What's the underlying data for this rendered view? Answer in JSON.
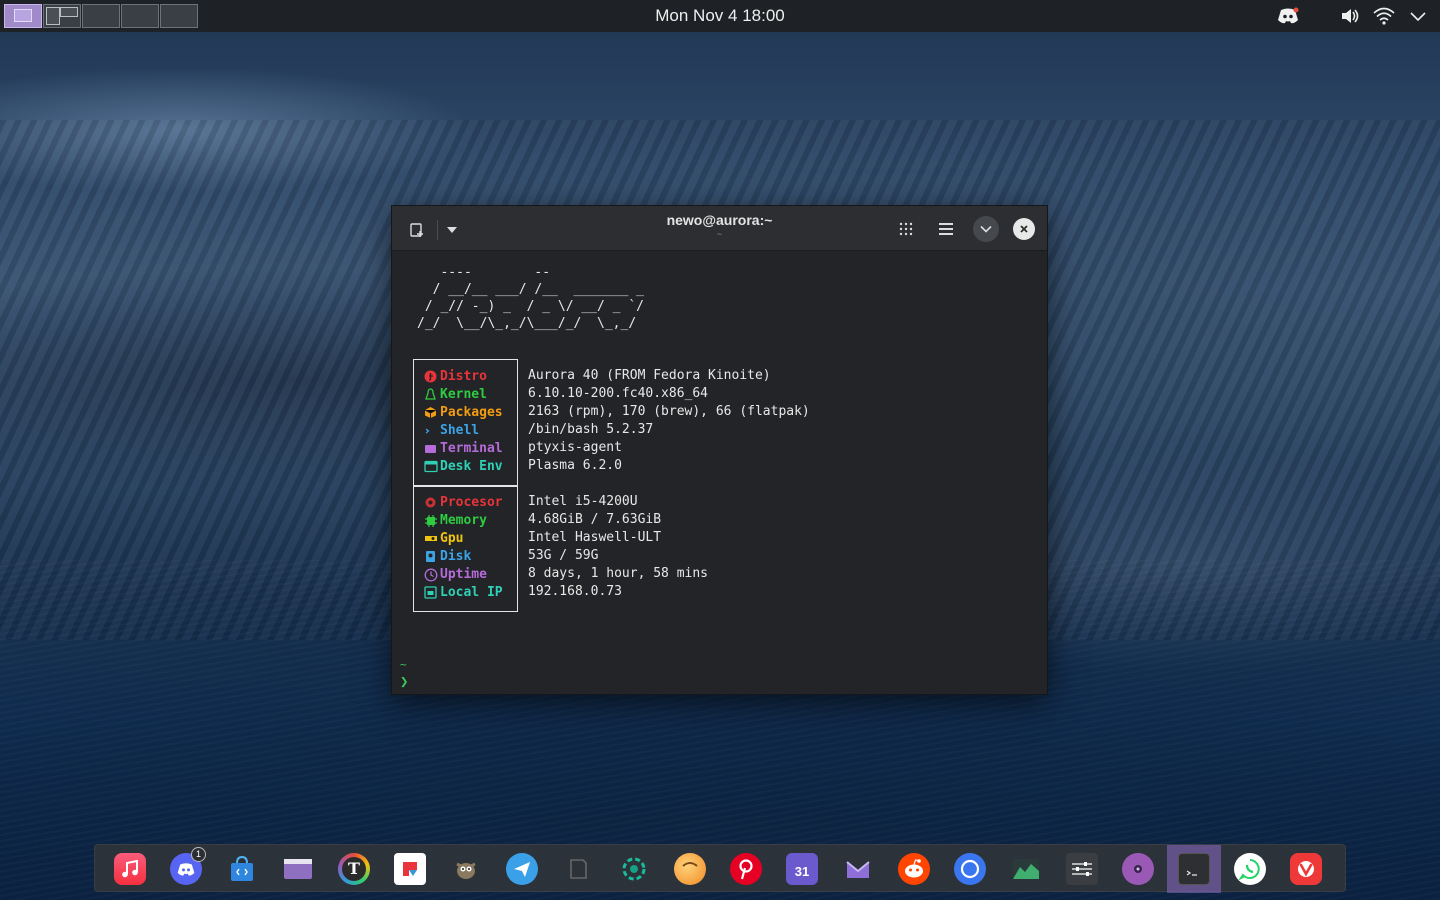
{
  "top_panel": {
    "clock": "Mon Nov 4  18:00",
    "tray_icons": [
      "discord-tray-icon",
      "volume-icon",
      "wifi-icon",
      "chevron-down-icon"
    ]
  },
  "terminal": {
    "title": "newo@aurora:~",
    "subtitle": "~",
    "ascii_logo": "   ----        --\n  / __/__ ___/ /__  _______ _\n / _// -_) _  / _ \\/ __/ _ `/\n/_/  \\__/\\_,_/\\___/_/  \\_,_/",
    "group1": [
      {
        "label": "Distro",
        "value": "Aurora 40 (FROM Fedora Kinoite)",
        "color": "#e8343a"
      },
      {
        "label": "Kernel",
        "value": "6.10.10-200.fc40.x86_64",
        "color": "#2ecc40"
      },
      {
        "label": "Packages",
        "value": "2163 (rpm), 170 (brew), 66 (flatpak)",
        "color": "#f39c12"
      },
      {
        "label": "Shell",
        "value": "/bin/bash 5.2.37",
        "color": "#3ba3e6"
      },
      {
        "label": "Terminal",
        "value": "ptyxis-agent",
        "color": "#b56bd8"
      },
      {
        "label": "Desk Env",
        "value": "Plasma 6.2.0",
        "color": "#2fd0b5"
      }
    ],
    "group2": [
      {
        "label": "Procesor",
        "value": "Intel i5-4200U",
        "color": "#e8343a"
      },
      {
        "label": "Memory",
        "value": "4.68GiB / 7.63GiB",
        "color": "#2ecc40"
      },
      {
        "label": "Gpu",
        "value": "Intel Haswell-ULT",
        "color": "#f1c40f"
      },
      {
        "label": "Disk",
        "value": "53G / 59G",
        "color": "#3ba3e6"
      },
      {
        "label": "Uptime",
        "value": "8 days, 1 hour, 58 mins",
        "color": "#b56bd8"
      },
      {
        "label": "Local IP",
        "value": "192.168.0.73",
        "color": "#2fd0b5"
      }
    ],
    "prompt_dir": "~",
    "prompt_symbol": "❯"
  },
  "dock": {
    "discord_badge": "1",
    "calendar_day": "31"
  }
}
